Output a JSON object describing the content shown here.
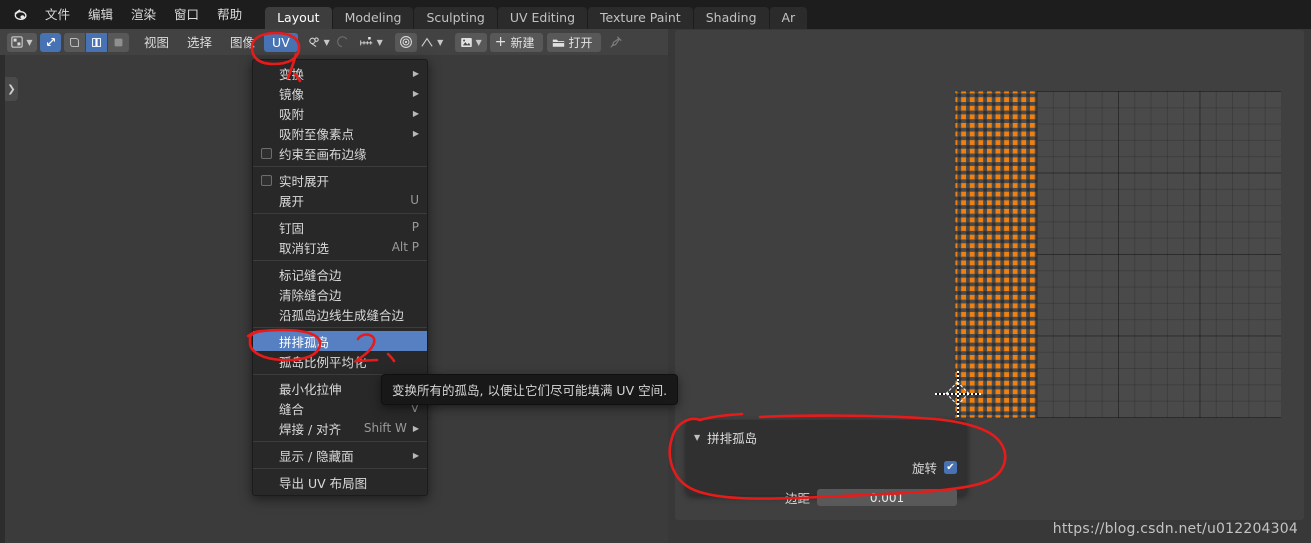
{
  "app": {
    "logo_icon": "blender-logo",
    "menus": [
      "文件",
      "编辑",
      "渲染",
      "窗口",
      "帮助"
    ],
    "workspace_tabs": [
      {
        "label": "Layout",
        "active": true
      },
      {
        "label": "Modeling",
        "active": false
      },
      {
        "label": "Sculpting",
        "active": false
      },
      {
        "label": "UV Editing",
        "active": false
      },
      {
        "label": "Texture Paint",
        "active": false
      },
      {
        "label": "Shading",
        "active": false
      },
      {
        "label": "Ar",
        "active": false
      }
    ]
  },
  "editor_header": {
    "editor_type_icon": "uv-editor-type-icon",
    "editor_type_chevron": "chevron-down-icon",
    "uv_sync_icon": "uv-sync-selection-icon",
    "select_modes": [
      {
        "icon": "uv-vertex-select-icon",
        "active": false
      },
      {
        "icon": "uv-edge-select-icon",
        "active": true
      },
      {
        "icon": "uv-face-select-icon",
        "active": false
      }
    ],
    "menus": [
      "视图",
      "选择",
      "图像"
    ],
    "uv_menu_label": "UV",
    "snap_icon": "snap-magnet-icon",
    "snap_chevron": "chevron-down-icon",
    "proportional_icon": "proportional-editing-icon",
    "proportional_ruler_icon": "uv-sticky-mode-icon",
    "proportional_chevron": "chevron-down-icon",
    "pivot_icon": "pivot-point-icon",
    "falloff_icon": "proportional-falloff-icon",
    "falloff_chevron": "chevron-down-icon",
    "image_browse_icon": "image-data-icon",
    "image_chevron": "chevron-down-icon",
    "new_icon": "plus-icon",
    "new_label": "新建",
    "open_icon": "folder-icon",
    "open_label": "打开",
    "pin_icon": "pin-icon"
  },
  "sidebar_toggle": {
    "icon": "chevron-right-icon"
  },
  "uv_menu": {
    "items": [
      {
        "label": "变换",
        "shortcut": "",
        "submenu": true,
        "checkbox": false,
        "checked": false,
        "highlight": false,
        "sep_after": false
      },
      {
        "label": "镜像",
        "shortcut": "",
        "submenu": true,
        "checkbox": false,
        "checked": false,
        "highlight": false,
        "sep_after": false
      },
      {
        "label": "吸附",
        "shortcut": "",
        "submenu": true,
        "checkbox": false,
        "checked": false,
        "highlight": false,
        "sep_after": false
      },
      {
        "label": "吸附至像素点",
        "shortcut": "",
        "submenu": true,
        "checkbox": false,
        "checked": false,
        "highlight": false,
        "sep_after": false
      },
      {
        "label": "约束至画布边缘",
        "shortcut": "",
        "submenu": false,
        "checkbox": true,
        "checked": false,
        "highlight": false,
        "sep_after": true
      },
      {
        "label": "实时展开",
        "shortcut": "",
        "submenu": false,
        "checkbox": true,
        "checked": false,
        "highlight": false,
        "sep_after": false
      },
      {
        "label": "展开",
        "shortcut": "U",
        "submenu": false,
        "checkbox": false,
        "checked": false,
        "highlight": false,
        "sep_after": true
      },
      {
        "label": "钉固",
        "shortcut": "P",
        "submenu": false,
        "checkbox": false,
        "checked": false,
        "highlight": false,
        "sep_after": false
      },
      {
        "label": "取消钉选",
        "shortcut": "Alt P",
        "submenu": false,
        "checkbox": false,
        "checked": false,
        "highlight": false,
        "sep_after": true
      },
      {
        "label": "标记缝合边",
        "shortcut": "",
        "submenu": false,
        "checkbox": false,
        "checked": false,
        "highlight": false,
        "sep_after": false
      },
      {
        "label": "清除缝合边",
        "shortcut": "",
        "submenu": false,
        "checkbox": false,
        "checked": false,
        "highlight": false,
        "sep_after": false
      },
      {
        "label": "沿孤岛边线生成缝合边",
        "shortcut": "",
        "submenu": false,
        "checkbox": false,
        "checked": false,
        "highlight": false,
        "sep_after": true
      },
      {
        "label": "拼排孤岛",
        "shortcut": "",
        "submenu": false,
        "checkbox": false,
        "checked": false,
        "highlight": true,
        "sep_after": false
      },
      {
        "label": "孤岛比例平均化",
        "shortcut": "",
        "submenu": false,
        "checkbox": false,
        "checked": false,
        "highlight": false,
        "sep_after": true
      },
      {
        "label": "最小化拉伸",
        "shortcut": "",
        "submenu": false,
        "checkbox": false,
        "checked": false,
        "highlight": false,
        "sep_after": false
      },
      {
        "label": "缝合",
        "shortcut": "V",
        "submenu": false,
        "checkbox": false,
        "checked": false,
        "highlight": false,
        "sep_after": false
      },
      {
        "label": "焊接 / 对齐",
        "shortcut": "Shift W",
        "submenu": true,
        "checkbox": false,
        "checked": false,
        "highlight": false,
        "sep_after": true
      },
      {
        "label": "显示 / 隐藏面",
        "shortcut": "",
        "submenu": true,
        "checkbox": false,
        "checked": false,
        "highlight": false,
        "sep_after": true
      },
      {
        "label": "导出 UV 布局图",
        "shortcut": "",
        "submenu": false,
        "checkbox": false,
        "checked": false,
        "highlight": false,
        "sep_after": false
      }
    ]
  },
  "tooltip": {
    "text": "变换所有的孤岛, 以便让它们尽可能填满 UV 空间."
  },
  "operator_panel": {
    "collapse_icon": "triangle-down-icon",
    "title": "拼排孤岛",
    "rotate_label": "旋转",
    "rotate_checked": true,
    "check_glyph": "✔",
    "margin_label": "边距",
    "margin_value": "0.001"
  },
  "uv_view": {
    "mesh_color": "#f08010",
    "cursor_icon": "2d-cursor-icon"
  },
  "annotations": {
    "mark_one": "1、",
    "mark_two": "2、",
    "color": "#e81b1b"
  },
  "watermark": {
    "text": "https://blog.csdn.net/u012204304"
  }
}
